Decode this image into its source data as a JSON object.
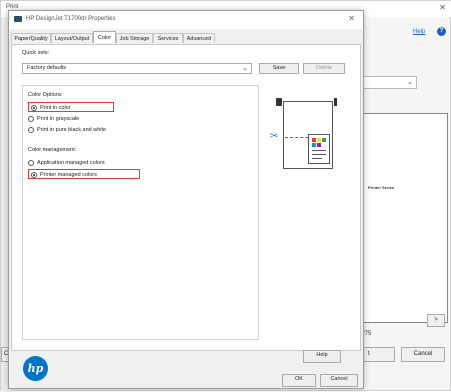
{
  "background_window": {
    "title": "Print",
    "help_link": "Help",
    "page_number_partial": "/75",
    "preview_snippet": "Printer Series",
    "bottom_left_partial": "C",
    "cancel_label": "Cancel",
    "ok_partial_label": "t",
    "next_page_symbol": ">"
  },
  "dialog": {
    "title": "HP DesignJet T1700dr Properties",
    "tabs": [
      {
        "label": "Paper/Quality",
        "active": false
      },
      {
        "label": "Layout/Output",
        "active": false
      },
      {
        "label": "Color",
        "active": true
      },
      {
        "label": "Job Storage",
        "active": false
      },
      {
        "label": "Services",
        "active": false
      },
      {
        "label": "Advanced",
        "active": false
      }
    ],
    "quick_sets": {
      "label": "Quick sets:",
      "value": "Factory defaults",
      "save_label": "Save",
      "delete_label": "Delete"
    },
    "color_options": {
      "title": "Color Options",
      "options": [
        {
          "label": "Print in color",
          "checked": true,
          "highlighted": true
        },
        {
          "label": "Print in grayscale",
          "checked": false,
          "highlighted": false
        },
        {
          "label": "Print in pure black and white",
          "checked": false,
          "highlighted": false
        }
      ]
    },
    "color_management": {
      "title": "Color management:",
      "options": [
        {
          "label": "Application managed colors",
          "checked": false,
          "highlighted": false
        },
        {
          "label": "Printer managed colors",
          "checked": true,
          "highlighted": true
        }
      ]
    },
    "help_label": "Help",
    "ok_label": "OK",
    "cancel_label": "Cancel",
    "logo_text": "hp"
  },
  "colors": {
    "highlight": "#e53935",
    "accent": "#2b6fd1",
    "hp_blue": "#0074c8"
  }
}
